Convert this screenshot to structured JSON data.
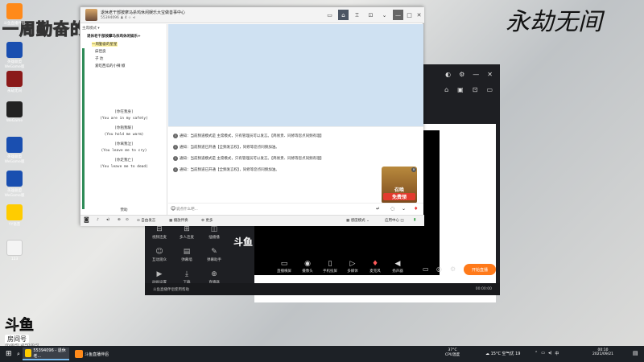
{
  "desktop": {
    "brand_left": "一周勤奋的星星",
    "brand_right": "永劫无间",
    "icons": [
      {
        "label": "斗鱼直播伴侣"
      },
      {
        "label": "英雄联盟\nWeGame版"
      },
      {
        "label": "永劫无间"
      },
      {
        "label": "WeGame"
      },
      {
        "label": "英雄联盟\nWeGame版"
      },
      {
        "label": "英雄联盟\nWeGame版"
      },
      {
        "label": "YY语音"
      },
      {
        "label": "123"
      }
    ],
    "room": {
      "logo": "斗鱼",
      "label": "房间号",
      "number": "9814781"
    }
  },
  "yy_window": {
    "title": "退休老干部按摩马杀鸡休闲娱乐大宝做善事中心",
    "channel_id": "55394096",
    "online": "4",
    "left_header": "主席模式 ▾",
    "tree": [
      "退休老干部按摩马杀鸡休闲娱乐+",
      "一周勤奋的星星",
      "床佳良",
      "子 达",
      "爱吃西瓜的小辣 椒"
    ],
    "lyrics": [
      "[你在我身]",
      "(You are in my safety)",
      "[你抱我暖]",
      "(You hold me warm)",
      "[你离我泣]",
      "(You leave me to cry)",
      "[你走我亡]",
      "(You leave me to dead)"
    ],
    "left_footer": "赞助",
    "notices": [
      "通知：当前频道模式是 主席模式，只有管理员可以发言。【简易贵、同修等您点同频有理】",
      "通知：当前频道已开通【全频发言权】，同修等您点同频加油。",
      "通知：当前频道模式是 主席模式，只有管理员可以发言。【简易贵、同修等您点同频有理】",
      "通知：当前频道已开通【全频发言权】，同修等您点同频加油。"
    ],
    "promo": {
      "line1": "召唤",
      "line2": "免费领"
    },
    "input_placeholder": "说点什么吧...",
    "bottom_bar": {
      "free_mic": "自由发言",
      "play": "播放伴奏",
      "settings": "更多",
      "sensitivity": "感度模式",
      "apps": "应用中心"
    }
  },
  "stream_tool": {
    "logo": "斗鱼",
    "left_tools": [
      "视频连麦",
      "多人连麦",
      "插播播",
      "互动观众",
      "弹幕墙",
      "弹幕助手",
      "动画设置",
      "下载",
      "直播器"
    ],
    "bottom_tools": [
      "直播横屏",
      "摄像头",
      "手机投屏",
      "多媒体",
      "麦克风",
      "扬声器"
    ],
    "start_label": "开始直播",
    "status_left": "斗鱼直播伴侣使用帮助",
    "status_right": "00:00:00"
  },
  "taskbar": {
    "items": [
      "55394096 - 退休老...",
      "斗鱼直播伴侣"
    ],
    "weather": "37°C",
    "cpu": "CPU温度",
    "temp": "15°C 空气优 19",
    "time": "00:10",
    "date": "2021/09/21"
  },
  "colors": {
    "brand_yellow": "#ffe600",
    "start_orange": "#ff7a1a",
    "yy_blue_area": "#cfe1f2",
    "taskbar": "#1d2126"
  }
}
